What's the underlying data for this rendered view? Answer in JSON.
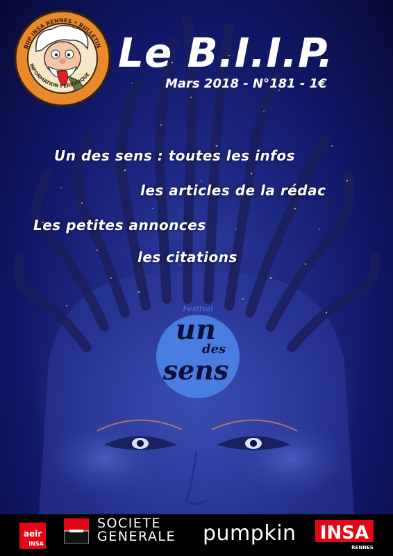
{
  "publication": {
    "title": "Le B.I.I.P.",
    "issue_line": "Mars 2018 - N°181 - 1€",
    "seal_text": "BIIP INSA RENNES • BULLETIN INSALIEN D'INFORMATION PÉRIODIQUE"
  },
  "headlines": [
    "Un des sens : toutes les infos",
    "les articles de la rédac",
    "Les petites annonces",
    "les citations"
  ],
  "festival_logo": {
    "small": "Festival",
    "line1": "un",
    "line2": "des",
    "line3": "sens"
  },
  "sponsors": {
    "aeir": {
      "top": "aeir",
      "bottom": "INSA"
    },
    "societe_generale": {
      "line1": "SOCIETE",
      "line2": "GENERALE"
    },
    "pumpkin": "pumpkin",
    "insa": {
      "main": "INSA",
      "sub": "RENNES"
    }
  },
  "colors": {
    "background_top": "#070a35",
    "background_glow": "#3c4fb8",
    "festival_disc": "#4a7de0",
    "seal_orange": "#e8892b",
    "sponsor_red": "#e30613",
    "text": "#ffffff"
  },
  "icons": [
    "mascot-seal-icon",
    "festival-logo-icon",
    "aeir-logo-icon",
    "societe-generale-logo-icon",
    "insa-logo-icon"
  ]
}
